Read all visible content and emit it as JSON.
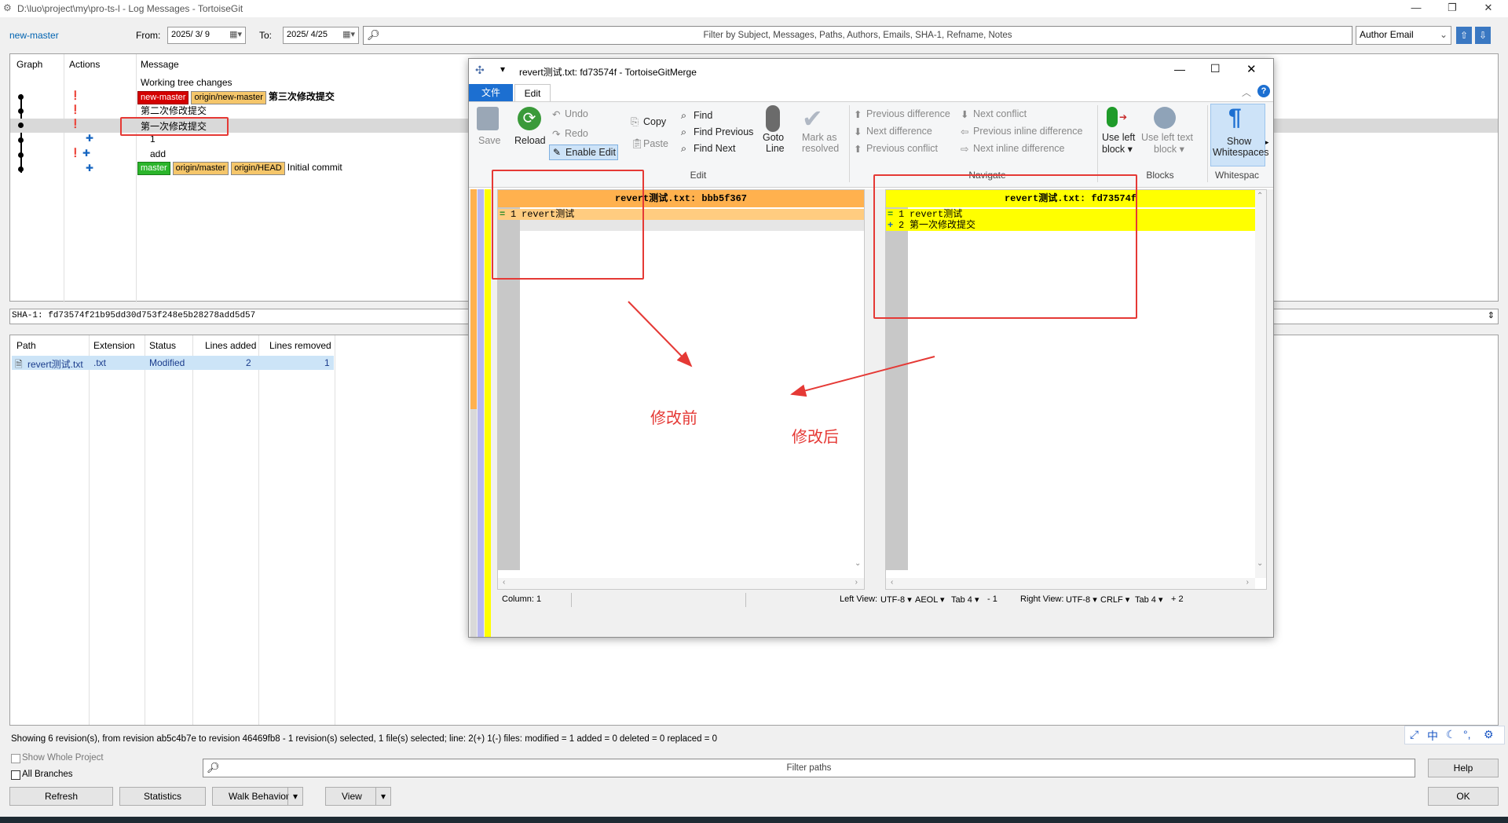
{
  "window": {
    "title": "D:\\luo\\project\\my\\pro-ts-l - Log Messages - TortoiseGit",
    "min": "—",
    "restore": "❐",
    "close": "✕"
  },
  "toolbar": {
    "branch": "new-master",
    "from_label": "From:",
    "from_value": "2025/ 3/ 9",
    "to_label": "To:",
    "to_value": "2025/ 4/25",
    "filter_placeholder": "Filter by Subject, Messages, Paths, Authors, Emails, SHA-1, Refname, Notes",
    "author_select": "Author Email"
  },
  "log": {
    "headers": {
      "graph": "Graph",
      "actions": "Actions",
      "message": "Message"
    },
    "rows": [
      {
        "message": "Working tree changes",
        "refs": []
      },
      {
        "message": "第三次修改提交",
        "refs": [
          "new-master",
          "origin/new-master"
        ]
      },
      {
        "message": "第二次修改提交",
        "refs": []
      },
      {
        "message": "第一次修改提交",
        "refs": []
      },
      {
        "message": "1",
        "refs": []
      },
      {
        "message": "add",
        "refs": []
      },
      {
        "message": "Initial commit",
        "refs": [
          "master",
          "origin/master",
          "origin/HEAD"
        ]
      }
    ]
  },
  "sha": "SHA-1: fd73574f21b95dd30d753f248e5b28278add5d57",
  "files": {
    "headers": {
      "path": "Path",
      "extension": "Extension",
      "status": "Status",
      "added": "Lines added",
      "removed": "Lines removed"
    },
    "rows": [
      {
        "path": "revert测试.txt",
        "extension": ".txt",
        "status": "Modified",
        "added": "2",
        "removed": "1"
      }
    ]
  },
  "status_line": "Showing 6 revision(s), from revision ab5c4b7e to revision 46469fb8 - 1 revision(s) selected, 1 file(s) selected; line: 2(+) 1(-) files: modified = 1 added = 0 deleted = 0 replaced = 0",
  "bottom": {
    "show_whole_project": "Show Whole Project",
    "all_branches": "All Branches",
    "filter_paths": "Filter paths",
    "help": "Help",
    "ok": "OK",
    "refresh": "Refresh",
    "statistics": "Statistics",
    "walk_behavior": "Walk Behavior",
    "view": "View"
  },
  "merge": {
    "title": "revert测试.txt: fd73574f - TortoiseGitMerge",
    "tab_file": "文件",
    "tab_edit": "Edit",
    "ribbon": {
      "save": "Save",
      "reload": "Reload",
      "undo": "Undo",
      "redo": "Redo",
      "enable_edit": "Enable Edit",
      "copy": "Copy",
      "paste": "Paste",
      "find": "Find",
      "find_previous": "Find Previous",
      "find_next": "Find Next",
      "goto_line_1": "Goto",
      "goto_line_2": "Line",
      "mark_1": "Mark as",
      "mark_2": "resolved",
      "group_edit": "Edit",
      "prev_diff": "Previous difference",
      "next_diff": "Next difference",
      "prev_conflict": "Previous conflict",
      "next_conflict": "Next conflict",
      "prev_inline": "Previous inline difference",
      "next_inline": "Next inline difference",
      "group_navigate": "Navigate",
      "use_left_block_1": "Use left",
      "use_left_block_2": "block ▾",
      "use_left_text_1": "Use left text",
      "use_left_text_2": "block ▾",
      "group_blocks": "Blocks",
      "show_ws_1": "Show",
      "show_ws_2": "Whitespaces",
      "group_whitespace": "Whitespac"
    },
    "left_pane": {
      "header": "revert测试.txt: bbb5f367",
      "lines": [
        {
          "num": "1",
          "mark": "=",
          "text": "revert测试"
        }
      ]
    },
    "right_pane": {
      "header": "revert测试.txt: fd73574f",
      "lines": [
        {
          "num": "1",
          "mark": "=",
          "text": "revert测试"
        },
        {
          "num": "2",
          "mark": "+",
          "text": "第一次修改提交"
        }
      ]
    },
    "status": {
      "column": "Column: 1",
      "left_view": "Left View:",
      "left_enc": "UTF-8 ▾",
      "left_eol": "AEOL ▾",
      "left_tab": "Tab 4 ▾",
      "left_count": "- 1",
      "right_view": "Right View:",
      "right_enc": "UTF-8 ▾",
      "right_eol": "CRLF ▾",
      "right_tab": "Tab 4 ▾",
      "right_count": "+ 2"
    }
  },
  "annotations": {
    "before": "修改前",
    "after": "修改后"
  },
  "ime": {
    "lang": "中"
  }
}
